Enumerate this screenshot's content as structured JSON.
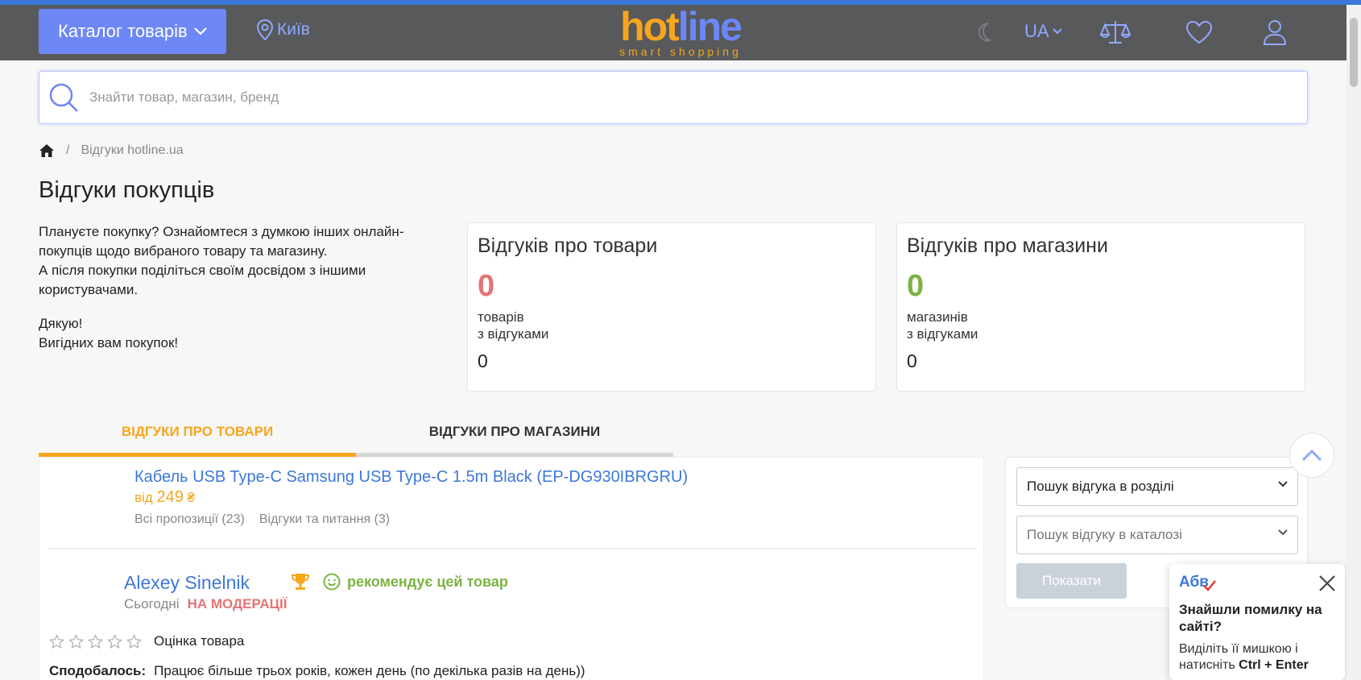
{
  "header": {
    "catalog_label": "Каталог товарів",
    "city": "Київ",
    "logo_main_a": "hot",
    "logo_main_b": "line",
    "logo_sub": "smart shopping",
    "lang": "UA"
  },
  "search": {
    "placeholder": "Знайти товар, магазин, бренд"
  },
  "breadcrumb": {
    "separator": "/",
    "current": "Відгуки hotline.ua"
  },
  "page": {
    "title": "Відгуки покупців",
    "intro_p1": "Плануєте покупку? Ознайомтеся з думкою інших онлайн-покупців щодо вибраного товару та магазину.",
    "intro_p1b": "А після покупки поділіться своїм досвідом з іншими користувачами.",
    "intro_p2a": "Дякую!",
    "intro_p2b": "Вигідних вам покупок!"
  },
  "stats": {
    "products": {
      "title": "Відгуків про товари",
      "number": "0",
      "label_a": "товарів",
      "label_b": "з відгуками",
      "count": "0",
      "color": "#e57373"
    },
    "shops": {
      "title": "Відгуків про магазини",
      "number": "0",
      "label_a": "магазинів",
      "label_b": "з відгуками",
      "count": "0",
      "color": "#7cb342"
    }
  },
  "tabs": {
    "products": "ВІДГУКИ ПРО ТОВАРИ",
    "shops": "ВІДГУКИ ПРО МАГАЗИНИ"
  },
  "review": {
    "product_name": "Кабель USB Type-C Samsung USB Type-C 1.5m Black (EP-DG930IBRGRU)",
    "price_prefix": "від",
    "price_value": "249",
    "currency": "₴",
    "all_offers": "Всі пропозиції (23)",
    "questions": "Відгуки та питання (3)",
    "author": "Alexey Sinelnik",
    "recommend": "рекомендує цей товар",
    "date": "Сьогодні",
    "status": "НА МОДЕРАЦІЇ",
    "rating_label": "Оцінка товара",
    "rating_stars": 0,
    "liked_label": "Сподобалось:",
    "liked_text": "Працює більше трьох років, кожен день (по декілька разів на день))"
  },
  "filters": {
    "section_select": "Пошук відгука в розділі",
    "catalog_select": "Пошук відгуку в каталозі",
    "show_button": "Показати"
  },
  "error_popup": {
    "badge": "Абв",
    "title": "Знайшли помилку на сайті?",
    "text": "Виділіть її мишкою і натисніть",
    "shortcut": "Ctrl + Enter"
  },
  "colors": {
    "accent_blue": "#6d87f6",
    "link_blue": "#3c78d8",
    "orange": "#f7a51d",
    "header_bg": "#58595b"
  }
}
